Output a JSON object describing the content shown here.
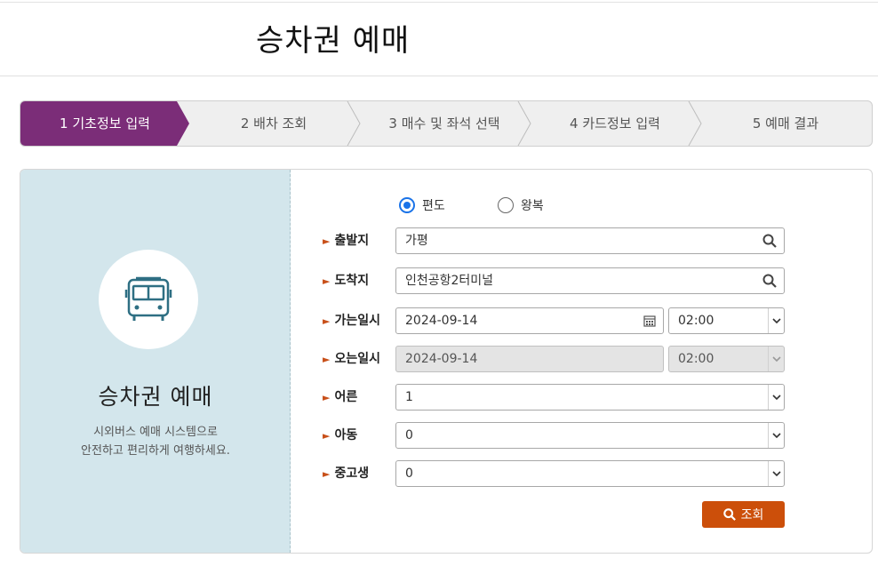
{
  "page": {
    "title": "승차권 예매"
  },
  "stepper": {
    "steps": [
      {
        "label": "1 기초정보 입력",
        "active": true
      },
      {
        "label": "2 배차 조회",
        "active": false
      },
      {
        "label": "3 매수 및 좌석 선택",
        "active": false
      },
      {
        "label": "4 카드정보 입력",
        "active": false
      },
      {
        "label": "5 예매 결과",
        "active": false
      }
    ],
    "active_color": "#7b2d78"
  },
  "left": {
    "icon": "bus-icon",
    "title": "승차권 예매",
    "desc_line1": "시외버스 예매 시스템으로",
    "desc_line2": "안전하고 편리하게 여행하세요."
  },
  "form": {
    "trip_type": {
      "one_way": "편도",
      "round_trip": "왕복",
      "selected": "one_way"
    },
    "departure": {
      "label": "출발지",
      "value": "가평"
    },
    "arrival": {
      "label": "도착지",
      "value": "인천공항2터미널"
    },
    "go_date": {
      "label": "가는일시",
      "date": "2024-09-14",
      "time": "02:00"
    },
    "return_date": {
      "label": "오는일시",
      "date": "2024-09-14",
      "time": "02:00"
    },
    "adult": {
      "label": "어른",
      "value": "1"
    },
    "child": {
      "label": "아동",
      "value": "0"
    },
    "student": {
      "label": "중고생",
      "value": "0"
    },
    "search_label": "조회"
  },
  "colors": {
    "accent": "#cc4f0a",
    "brand_purple": "#7b2d78",
    "left_bg": "#d3e6ec",
    "radio_blue": "#1a73e8"
  }
}
